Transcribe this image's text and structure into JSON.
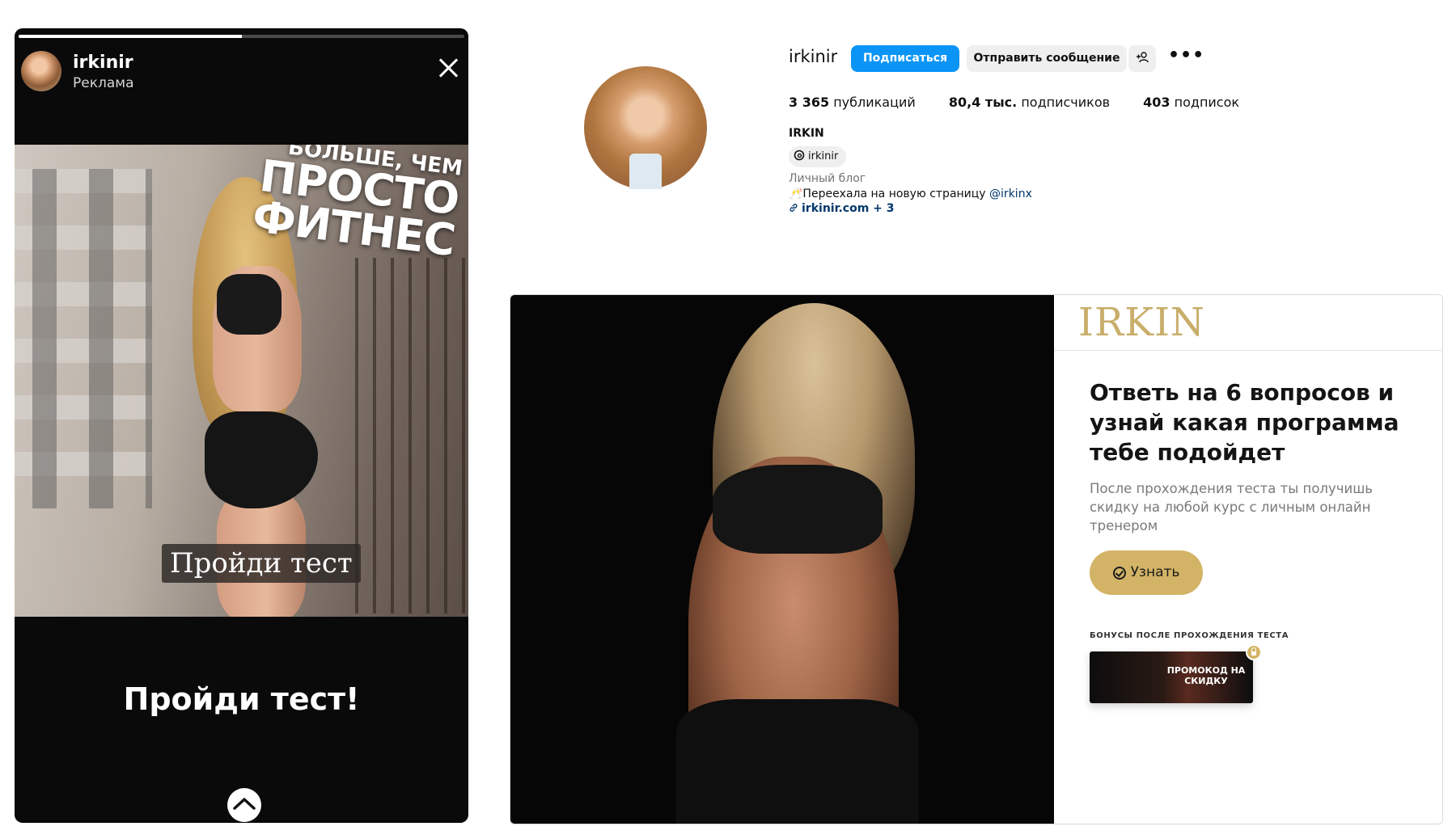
{
  "story": {
    "username": "irkinir",
    "sponsored_label": "Реклама",
    "progress_fraction": 0.5,
    "overlay_headline": [
      "БОЛЬШЕ, ЧЕМ",
      "ПРОСТО",
      "ФИТНЕС"
    ],
    "overlay_cta": "Пройди тест",
    "bottom_text": "Пройди тест!",
    "icons": {
      "close": "close-icon",
      "swipe_up": "chevron-up-icon"
    }
  },
  "profile": {
    "username": "irkinir",
    "follow_label": "Подписаться",
    "message_label": "Отправить сообщение",
    "suggest_label": "+ᴙ",
    "more_label": "•••",
    "stats": [
      {
        "value": "3 365",
        "label": "публикаций"
      },
      {
        "value": "80,4 тыс.",
        "label": "подписчиков"
      },
      {
        "value": "403",
        "label": "подписок"
      }
    ],
    "name": "IRKIN",
    "threads_handle": "irkinir",
    "category": "Личный блог",
    "bio_prefix": "🥂Переехала на новую страницу ",
    "bio_mention": "@irkinx",
    "link": "irkinir.com + 3",
    "colors": {
      "follow_button": "#0a95f6",
      "link": "#00376b"
    }
  },
  "landing": {
    "logo": "IRKIN",
    "heading": "Ответь на 6 вопросов и узнай какая программа тебе подойдет",
    "subtext": "После прохождения теста ты получишь скидку на любой курс с личным онлайн тренером",
    "cta_label": "Узнать",
    "bonus_label": "БОНУСЫ ПОСЛЕ ПРОХОЖДЕНИЯ ТЕСТА",
    "bonus_card_text": "ПРОМОКОД НА СКИДКУ",
    "colors": {
      "accent_gold": "#d3b466",
      "logo_gold": "#c9ad6a"
    }
  }
}
